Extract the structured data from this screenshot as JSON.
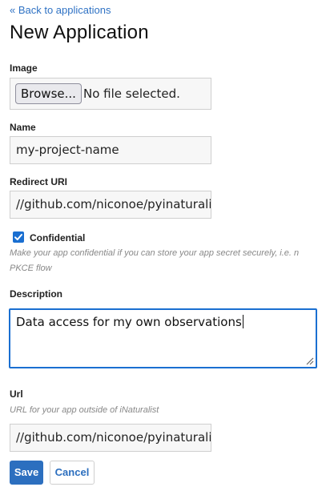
{
  "nav": {
    "back_label": "« Back to applications"
  },
  "page": {
    "title": "New Application"
  },
  "image_field": {
    "label": "Image",
    "browse_label": "Browse...",
    "status": "No file selected."
  },
  "name_field": {
    "label": "Name",
    "value": "my-project-name"
  },
  "redirect_field": {
    "label": "Redirect URI",
    "value": "//github.com/niconoe/pyinaturalist"
  },
  "confidential": {
    "label": "Confidential",
    "checked": true,
    "hint_line1": "Make your app confidential if you can store your app secret securely, i.e. n",
    "hint_line2": "PKCE flow"
  },
  "description_field": {
    "label": "Description",
    "value": "Data access for my own observations"
  },
  "url_field": {
    "label": "Url",
    "hint": "URL for your app outside of iNaturalist",
    "value": "//github.com/niconoe/pyinaturalist"
  },
  "actions": {
    "save_label": "Save",
    "cancel_label": "Cancel"
  },
  "colors": {
    "accent": "#2c6fbf",
    "focus": "#1a6fd1",
    "hint": "#888888"
  }
}
